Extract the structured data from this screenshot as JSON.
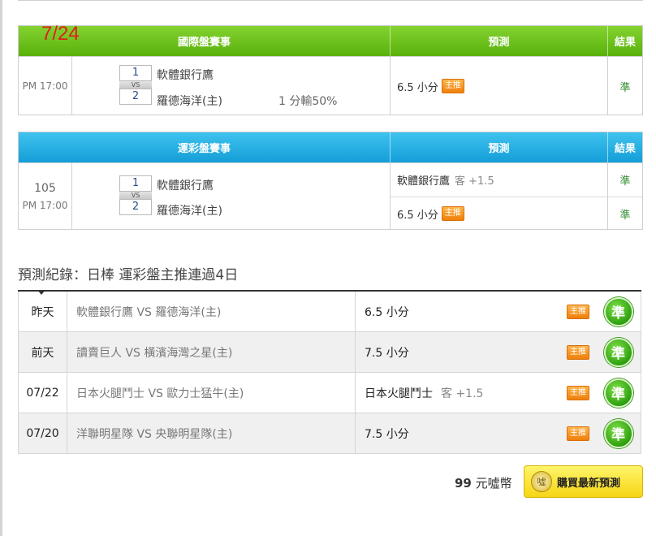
{
  "date_mark": "7/24",
  "intl_table": {
    "header": {
      "game": "國際盤賽事",
      "prediction": "預測",
      "result": "結果"
    },
    "time": "PM 17:00",
    "team1_num": "1",
    "team2_num": "2",
    "vs": "VS",
    "team1": "軟體銀行鷹",
    "team2": "羅德海洋(主)",
    "handicap": "1 分輸50%",
    "prediction": "6.5 小分",
    "badge": "主推",
    "result": "準"
  },
  "lottery_table": {
    "header": {
      "game": "運彩盤賽事",
      "prediction": "預測",
      "result": "結果"
    },
    "game_no": "105",
    "time": "PM 17:00",
    "team1_num": "1",
    "team2_num": "2",
    "vs": "VS",
    "team1": "軟體銀行鷹",
    "team2": "羅德海洋(主)",
    "predictions": [
      {
        "text": "軟體銀行鷹",
        "extra": "客 +1.5",
        "badge": ""
      },
      {
        "text": "6.5 小分",
        "extra": "",
        "badge": "主推"
      }
    ],
    "results": [
      "準",
      "準"
    ]
  },
  "record": {
    "title": "預測紀錄：日棒 運彩盤主推連過4日",
    "rows": [
      {
        "day": "昨天",
        "match": "軟體銀行鷹 VS 羅德海洋(主)",
        "pred": "6.5 小分",
        "extra": "",
        "badge": "主推",
        "result": "準"
      },
      {
        "day": "前天",
        "match": "讀賣巨人 VS 橫濱海灣之星(主)",
        "pred": "7.5 小分",
        "extra": "",
        "badge": "主推",
        "result": "準"
      },
      {
        "day": "07/22",
        "match": "日本火腿鬥士 VS 歐力士猛牛(主)",
        "pred": "日本火腿鬥士",
        "extra": "客 +1.5",
        "badge": "主推",
        "result": "準"
      },
      {
        "day": "07/20",
        "match": "洋聯明星隊 VS 央聯明星隊(主)",
        "pred": "7.5 小分",
        "extra": "",
        "badge": "主推",
        "result": "準"
      }
    ]
  },
  "footer": {
    "price_num": "99",
    "price_unit": "元噓幣",
    "coin_label": "噓",
    "buy_label": "購買最新預測"
  },
  "colors": {
    "green_header": "#59b10b",
    "blue_header": "#149ed8",
    "badge_orange": "#ef7f0b",
    "result_green": "#2f8b2f",
    "date_red": "#e31b1b",
    "buy_yellow": "#f6d514"
  }
}
